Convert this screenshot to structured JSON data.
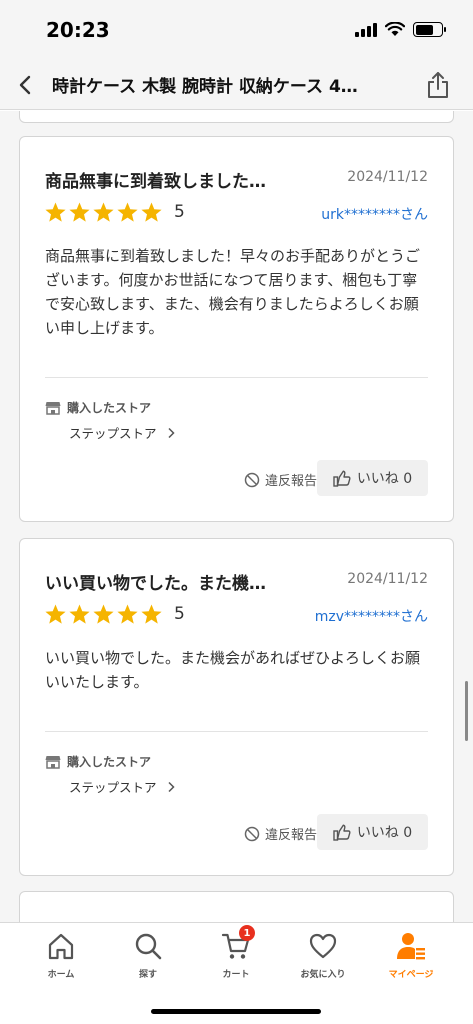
{
  "status": {
    "time": "20:23"
  },
  "header": {
    "title": "時計ケース 木製 腕時計 収納ケース 4…"
  },
  "reviews": [
    {
      "title": "商品無事に到着致しました…",
      "date": "2024/11/12",
      "rating": "5",
      "reviewer": "urk********さん",
      "body": "商品無事に到着致しました！早々のお手配ありがとうございます。何度かお世話になつて居ります、梱包も丁寧で安心致します、また、機会有りましたらよろしくお願い申し上げます。",
      "store_label": "購入したストア",
      "store_name": "ステップストア",
      "report_label": "違反報告",
      "like_label": "いいね 0"
    },
    {
      "title": "いい買い物でした。また機…",
      "date": "2024/11/12",
      "rating": "5",
      "reviewer": "mzv********さん",
      "body": "いい買い物でした。また機会があればぜひよろしくお願いいたします。",
      "store_label": "購入したストア",
      "store_name": "ステップストア",
      "report_label": "違反報告",
      "like_label": "いいね 0"
    }
  ],
  "tabs": [
    {
      "label": "ホーム",
      "icon": "home-icon"
    },
    {
      "label": "探す",
      "icon": "search-icon"
    },
    {
      "label": "カート",
      "icon": "cart-icon",
      "badge": "1"
    },
    {
      "label": "お気に入り",
      "icon": "heart-icon"
    },
    {
      "label": "マイページ",
      "icon": "user-icon",
      "active": true
    }
  ],
  "colors": {
    "accent": "#ff7d00",
    "star": "#f5b400",
    "link": "#1f6fd1",
    "badge": "#e8301f"
  }
}
